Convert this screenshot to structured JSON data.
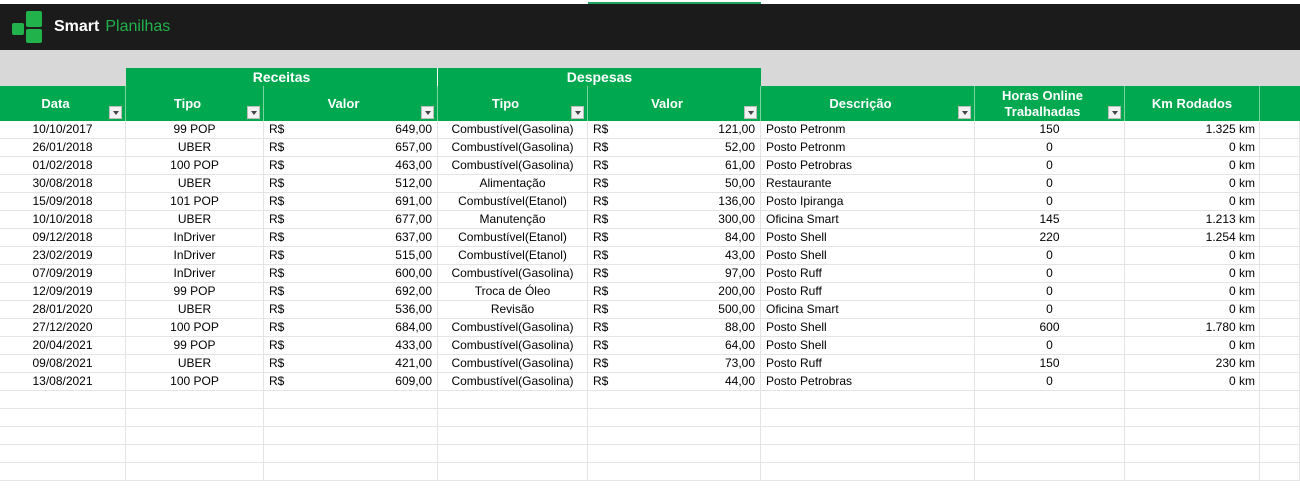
{
  "brand": {
    "bold": "Smart",
    "light": "Planilhas"
  },
  "colors": {
    "accent": "#00a84f",
    "banner": "#1b1b1b",
    "band": "#d8d8d8"
  },
  "groups": {
    "receitas": "Receitas",
    "despesas": "Despesas"
  },
  "headers": {
    "data": "Data",
    "tipo_r": "Tipo",
    "valor_r": "Valor",
    "tipo_d": "Tipo",
    "valor_d": "Valor",
    "descricao": "Descrição",
    "horas_1": "Horas Online",
    "horas_2": "Trabalhadas",
    "km": "Km Rodados"
  },
  "currency": "R$",
  "rows": [
    {
      "data": "10/10/2017",
      "tipo_r": "99 POP",
      "valor_r": "649,00",
      "tipo_d": "Combustível(Gasolina)",
      "valor_d": "121,00",
      "descricao": "Posto Petronm",
      "horas": "150",
      "km": "1.325 km"
    },
    {
      "data": "26/01/2018",
      "tipo_r": "UBER",
      "valor_r": "657,00",
      "tipo_d": "Combustível(Gasolina)",
      "valor_d": "52,00",
      "descricao": "Posto Petronm",
      "horas": "0",
      "km": "0 km"
    },
    {
      "data": "01/02/2018",
      "tipo_r": "100 POP",
      "valor_r": "463,00",
      "tipo_d": "Combustível(Gasolina)",
      "valor_d": "61,00",
      "descricao": "Posto Petrobras",
      "horas": "0",
      "km": "0 km"
    },
    {
      "data": "30/08/2018",
      "tipo_r": "UBER",
      "valor_r": "512,00",
      "tipo_d": "Alimentação",
      "valor_d": "50,00",
      "descricao": "Restaurante",
      "horas": "0",
      "km": "0 km"
    },
    {
      "data": "15/09/2018",
      "tipo_r": "101 POP",
      "valor_r": "691,00",
      "tipo_d": "Combustível(Etanol)",
      "valor_d": "136,00",
      "descricao": "Posto Ipiranga",
      "horas": "0",
      "km": "0 km"
    },
    {
      "data": "10/10/2018",
      "tipo_r": "UBER",
      "valor_r": "677,00",
      "tipo_d": "Manutenção",
      "valor_d": "300,00",
      "descricao": "Oficina Smart",
      "horas": "145",
      "km": "1.213 km"
    },
    {
      "data": "09/12/2018",
      "tipo_r": "InDriver",
      "valor_r": "637,00",
      "tipo_d": "Combustível(Etanol)",
      "valor_d": "84,00",
      "descricao": "Posto Shell",
      "horas": "220",
      "km": "1.254 km"
    },
    {
      "data": "23/02/2019",
      "tipo_r": "InDriver",
      "valor_r": "515,00",
      "tipo_d": "Combustível(Etanol)",
      "valor_d": "43,00",
      "descricao": "Posto Shell",
      "horas": "0",
      "km": "0 km"
    },
    {
      "data": "07/09/2019",
      "tipo_r": "InDriver",
      "valor_r": "600,00",
      "tipo_d": "Combustível(Gasolina)",
      "valor_d": "97,00",
      "descricao": "Posto Ruff",
      "horas": "0",
      "km": "0 km"
    },
    {
      "data": "12/09/2019",
      "tipo_r": "99 POP",
      "valor_r": "692,00",
      "tipo_d": "Troca de Óleo",
      "valor_d": "200,00",
      "descricao": "Posto Ruff",
      "horas": "0",
      "km": "0 km"
    },
    {
      "data": "28/01/2020",
      "tipo_r": "UBER",
      "valor_r": "536,00",
      "tipo_d": "Revisão",
      "valor_d": "500,00",
      "descricao": "Oficina Smart",
      "horas": "0",
      "km": "0 km"
    },
    {
      "data": "27/12/2020",
      "tipo_r": "100 POP",
      "valor_r": "684,00",
      "tipo_d": "Combustível(Gasolina)",
      "valor_d": "88,00",
      "descricao": "Posto Shell",
      "horas": "600",
      "km": "1.780 km"
    },
    {
      "data": "20/04/2021",
      "tipo_r": "99 POP",
      "valor_r": "433,00",
      "tipo_d": "Combustível(Gasolina)",
      "valor_d": "64,00",
      "descricao": "Posto Shell",
      "horas": "0",
      "km": "0 km"
    },
    {
      "data": "09/08/2021",
      "tipo_r": "UBER",
      "valor_r": "421,00",
      "tipo_d": "Combustível(Gasolina)",
      "valor_d": "73,00",
      "descricao": "Posto Ruff",
      "horas": "150",
      "km": "230 km"
    },
    {
      "data": "13/08/2021",
      "tipo_r": "100 POP",
      "valor_r": "609,00",
      "tipo_d": "Combustível(Gasolina)",
      "valor_d": "44,00",
      "descricao": "Posto Petrobras",
      "horas": "0",
      "km": "0 km"
    }
  ]
}
